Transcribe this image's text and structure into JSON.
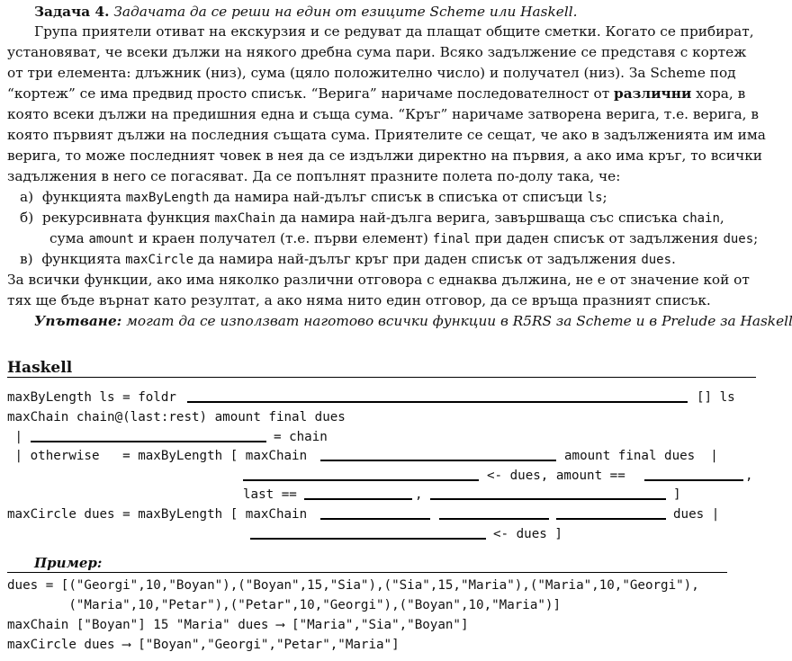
{
  "task": {
    "label": "Задача 4.",
    "subtitle": "Задачата да се реши на един от езиците Scheme или Haskell."
  },
  "intro_lines": [
    "Група приятели отиват на екскурзия и се редуват да плащат общите сметки. Когато се прибират,",
    "установяват, че всеки дължи на някого дребна сума пари. Всяко задължение се представя с кортеж",
    "от три елемента: длъжник (низ), сума (цяло положително число) и получател (низ). За Scheme под",
    "“кортеж” се има предвид просто списък. “Верига” наричаме последователност от ",
    "различни",
    " хора, в",
    "която всеки дължи на предишния една и съща сума. “Кръг” наричаме затворена верига, т.е. верига, в",
    "която първият дължи на последния същата сума. Приятелите се сещат, че ако в задълженията им има",
    "верига, то може последният човек в нея да се издължи директно на първия, а ако има кръг, то всички",
    "задължения в него се погасяват. Да се попълнят празните полета по-долу така, че:"
  ],
  "items": {
    "a_marker": "а)",
    "a_text1": "функцията ",
    "a_code1": "maxByLength",
    "a_text2": " да намира най-дълъг списък в списъка от списъци ",
    "a_code2": "ls",
    "a_text3": ";",
    "b_marker": "б)",
    "b_text1": "рекурсивната функция ",
    "b_code1": "maxChain",
    "b_text2": " да намира най-дълга верига, завършваща със списъка ",
    "b_code2": "chain",
    "b_text3": ",",
    "b2_text1": "сума ",
    "b2_code1": "amount",
    "b2_text2": " и краен получател (т.е. първи елемент) ",
    "b2_code2": "final",
    "b2_text3": " при даден списък от задължения ",
    "b2_code3": "dues",
    "b2_text4": ";",
    "c_marker": "в)",
    "c_text1": "функцията ",
    "c_code1": "maxCircle",
    "c_text2": " да намира най-дълъг кръг при даден списък от задължения ",
    "c_code2": "dues",
    "c_text3": "."
  },
  "outro_lines": [
    "За всички функции, ако има няколко различни отговора с еднаква дължина, не е от значение кой от",
    "тях ще бъде върнат като резултат, а ако няма нито един отговор, да се връща празният списък."
  ],
  "hint": {
    "label": "Упътване:",
    "text": " могат да се използват наготово всички функции в R5RS за Scheme и в Prelude за Haskell."
  },
  "section": "Haskell",
  "code": {
    "l1a": "maxByLength ls = foldr",
    "l1b": "[] ls",
    "l2": "maxChain chain@(last:rest) amount final dues",
    "l3a": " |",
    "l3b": "= chain",
    "l4a": " | otherwise   = maxByLength [ maxChain",
    "l4b": "amount final dues  |",
    "l5a": "<- dues, amount ==",
    "l5b": ",",
    "l6a": "last ==",
    "l6b": ",",
    "l6c": "]",
    "l7a": "maxCircle dues = maxByLength [ maxChain",
    "l7b": "dues |",
    "l8a": "<- dues ]"
  },
  "example": {
    "title": "Пример:",
    "lines": [
      "dues = [(\"Georgi\",10,\"Boyan\"),(\"Boyan\",15,\"Sia\"),(\"Sia\",15,\"Maria\"),(\"Maria\",10,\"Georgi\"),",
      "        (\"Maria\",10,\"Petar\"),(\"Petar\",10,\"Georgi\"),(\"Boyan\",10,\"Maria\")]",
      "maxChain [\"Boyan\"] 15 \"Maria\" dues ⟶ [\"Maria\",\"Sia\",\"Boyan\"]",
      "maxCircle dues ⟶ [\"Boyan\",\"Georgi\",\"Petar\",\"Maria\"]"
    ]
  }
}
